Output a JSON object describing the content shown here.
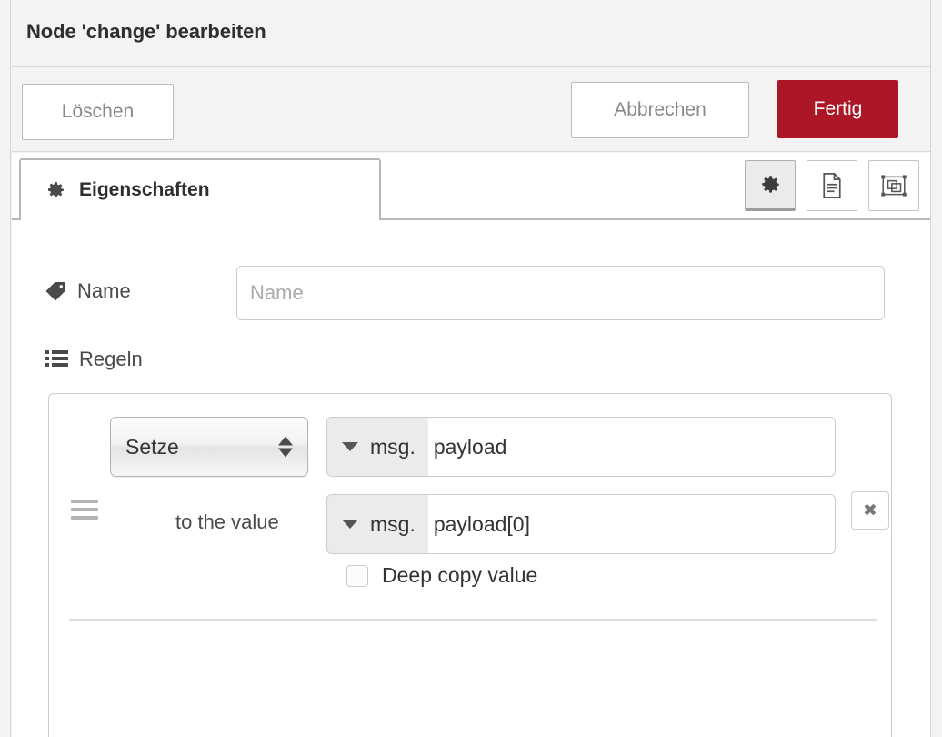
{
  "dialog": {
    "title": "Node 'change' bearbeiten"
  },
  "buttons": {
    "delete": "Löschen",
    "cancel": "Abbrechen",
    "done": "Fertig",
    "done_color": "#ad1625"
  },
  "tabs": [
    {
      "id": "properties",
      "label": "Eigenschaften",
      "icon": "gear-icon",
      "active": true
    }
  ],
  "icon_buttons": [
    {
      "id": "settings",
      "icon": "gear-icon",
      "active": true
    },
    {
      "id": "description",
      "icon": "document-icon",
      "active": false
    },
    {
      "id": "appearance",
      "icon": "appearance-icon",
      "active": false
    }
  ],
  "form": {
    "name": {
      "icon": "tag-icon",
      "label": "Name",
      "value": "",
      "placeholder": "Name"
    },
    "rules": {
      "icon": "list-icon",
      "label": "Regeln",
      "items": [
        {
          "action": "Setze",
          "target": {
            "prefix": "msg.",
            "value": "payload"
          },
          "value_label": "to the value",
          "source": {
            "prefix": "msg.",
            "value": "payload[0]"
          },
          "deep_copy": {
            "label": "Deep copy value",
            "checked": false
          },
          "delete_label": "✖"
        }
      ]
    }
  }
}
